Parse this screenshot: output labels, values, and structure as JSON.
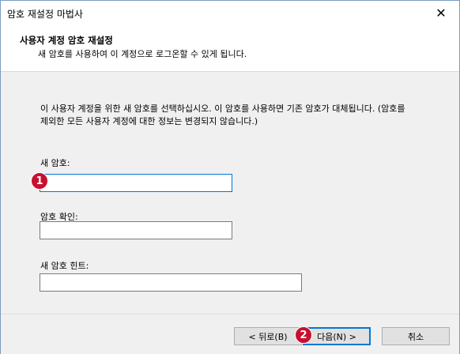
{
  "window": {
    "title": "암호 재설정 마법사",
    "close_glyph": "✕"
  },
  "header": {
    "title": "사용자 계정 암호 재설정",
    "subtitle": "새 암호를 사용하여 이 계정으로 로그온할 수 있게 됩니다."
  },
  "main": {
    "description": "이 사용자 계정을 위한 새 암호를 선택하십시오. 이 암호를 사용하면 기존 암호가 대체됩니다. (암호를 제외한 모든 사용자 계정에 대한 정보는 변경되지 않습니다.)",
    "new_password_label": "새 암호:",
    "new_password_value": "",
    "confirm_password_label": "암호 확인:",
    "confirm_password_value": "",
    "hint_label": "새 암호 힌트:",
    "hint_value": ""
  },
  "footer": {
    "back_label": "< 뒤로(B)",
    "next_label": "다음(N) >",
    "cancel_label": "취소"
  },
  "annotations": {
    "marker1": "1",
    "marker2": "2",
    "marker_color": "#c8102e"
  }
}
